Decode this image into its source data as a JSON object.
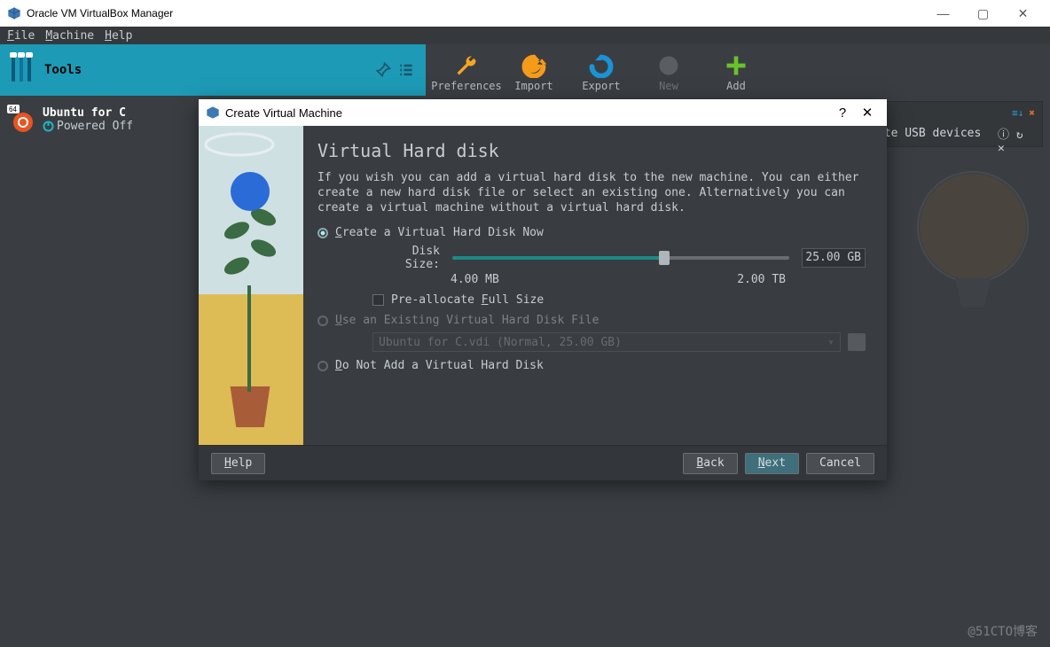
{
  "titlebar": {
    "title": "Oracle VM VirtualBox Manager"
  },
  "menubar": {
    "file": "File",
    "machine": "Machine",
    "help": "Help"
  },
  "toolbar": {
    "tools_label": "Tools",
    "preferences": "Preferences",
    "import": "Import",
    "export": "Export",
    "new": "New",
    "add": "Add"
  },
  "notif": {
    "text": "Can't enumerate USB devices ..."
  },
  "vm": {
    "name": "Ubuntu for C",
    "state": "Powered Off",
    "badge": "64"
  },
  "dialog": {
    "title": "Create Virtual Machine",
    "heading": "Virtual Hard disk",
    "description": "If you wish you can add a virtual hard disk to the new machine. You can either create a new hard disk file or select an existing one. Alternatively you can create a virtual machine without a virtual hard disk.",
    "options": {
      "create": "Create a Virtual Hard Disk Now",
      "use_existing": "Use an Existing Virtual Hard Disk File",
      "do_not_add": "Do Not Add a Virtual Hard Disk"
    },
    "disk_size_label": "Disk Size:",
    "disk_size_min": "4.00 MB",
    "disk_size_max": "2.00 TB",
    "disk_size_value": "25.00 GB",
    "prealloc_label": "Pre-allocate Full Size",
    "existing_file": "Ubuntu for C.vdi (Normal, 25.00 GB)",
    "buttons": {
      "help": "Help",
      "back": "Back",
      "next": "Next",
      "cancel": "Cancel"
    }
  },
  "watermark": "@51CTO博客"
}
